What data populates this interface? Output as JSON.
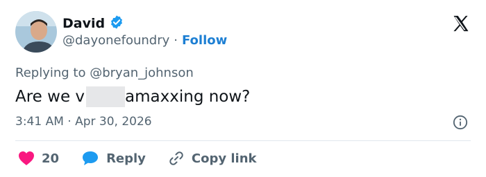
{
  "author": {
    "name": "David",
    "handle": "@dayonefoundry",
    "follow_label": "Follow",
    "verified_color": "#1d9bf0"
  },
  "reply": {
    "prefix": "Replying to",
    "to": "@bryan_johnson"
  },
  "tweet": {
    "text_before": "Are we v",
    "text_after": "amaxxing now?"
  },
  "meta": {
    "time": "3:41 AM",
    "date": "Apr 30, 2026"
  },
  "actions": {
    "like_count": "20",
    "reply_label": "Reply",
    "copy_label": "Copy link"
  },
  "colors": {
    "like": "#f91880",
    "reply": "#1d9bf0",
    "follow": "#1d7fd3"
  },
  "icons": [
    "verified-badge-icon",
    "x-logo-icon",
    "info-icon",
    "heart-icon",
    "reply-bubble-icon",
    "link-icon"
  ]
}
